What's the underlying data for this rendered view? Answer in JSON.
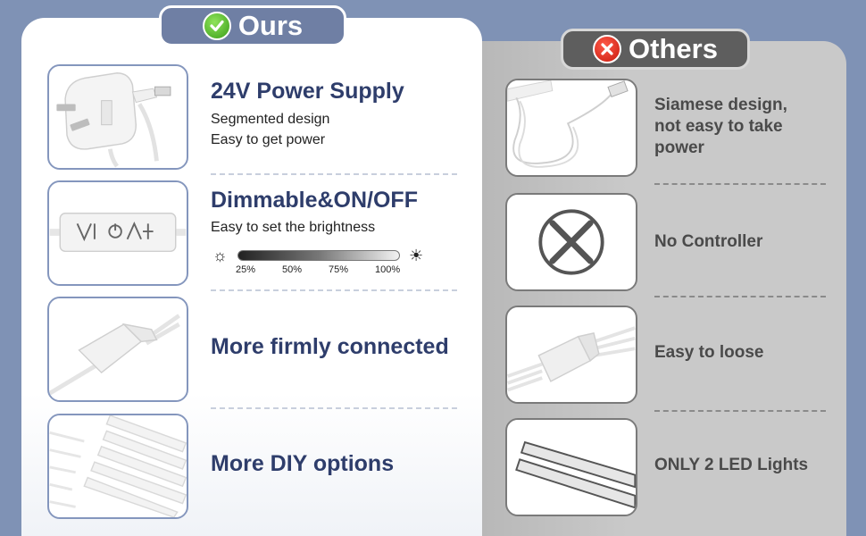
{
  "tabs": {
    "ours": "Ours",
    "others": "Others"
  },
  "ours": [
    {
      "title": "24V Power Supply",
      "lines": [
        "Segmented design",
        "Easy to get power"
      ],
      "image": "power-adapter-image"
    },
    {
      "title": "Dimmable&ON/OFF",
      "lines": [
        "Easy to set the brightness"
      ],
      "image": "dimmer-switch-image"
    },
    {
      "title": "More firmly connected",
      "lines": [],
      "image": "connector-image"
    },
    {
      "title": "More DIY options",
      "lines": [],
      "image": "led-bars-image"
    }
  ],
  "brightness": {
    "levels": [
      "25%",
      "50%",
      "75%",
      "100%"
    ],
    "icons": [
      "dim-sun-icon",
      "bright-sun-icon"
    ]
  },
  "others": [
    {
      "text": "Siamese design, not easy to take power",
      "image": "usb-led-bar-image"
    },
    {
      "text": "No Controller",
      "image": "no-controller-icon"
    },
    {
      "text": "Easy to loose",
      "image": "loose-connector-image"
    },
    {
      "text": "ONLY 2 LED Lights",
      "image": "two-led-bars-image"
    }
  ],
  "colors": {
    "background": "#7f92b5",
    "title": "#2e3d6b",
    "ours_tab": "#6f7fa4",
    "others_tab": "#5e5e5e",
    "check": "#3a9d19",
    "cross": "#c8190c"
  }
}
